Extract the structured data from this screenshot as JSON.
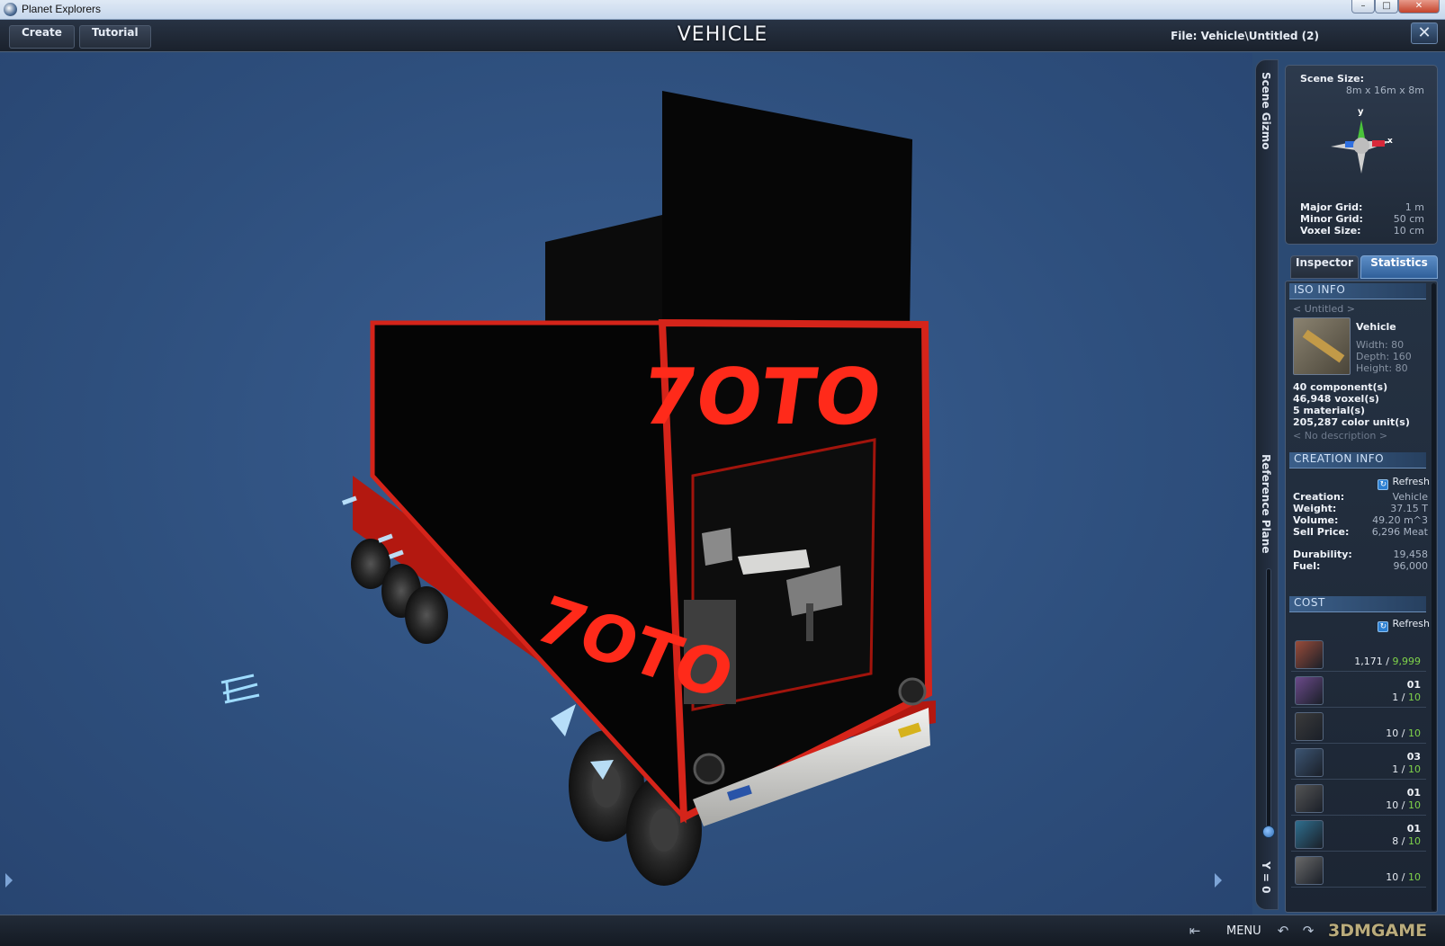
{
  "os_window": {
    "title": "Planet Explorers",
    "controls": {
      "minimize": "–",
      "maximize": "□",
      "close": "✕"
    }
  },
  "header": {
    "create_label": "Create",
    "tutorial_label": "Tutorial",
    "title": "VEHICLE",
    "file_path": "File:  Vehicle\\Untitled (2)",
    "close_glyph": "✕"
  },
  "model": {
    "front_logo": "7OTO",
    "side_logo": "7OTO",
    "colors": {
      "body": "#070707",
      "frame": "#c41a12",
      "glow": "#ff2a1a",
      "bumper": "#d7d7d5",
      "bg": "#2e4f7d"
    }
  },
  "side_labels": {
    "scene_gizmo": "Scene Gizmo",
    "reference_plane": "Reference Plane",
    "y_value": "Y = 0"
  },
  "scene": {
    "size_label": "Scene Size:",
    "size_value": "8m x 16m x 8m",
    "axis_y": "y",
    "axis_x": "x",
    "major_grid_label": "Major Grid:",
    "major_grid_value": "1 m",
    "minor_grid_label": "Minor Grid:",
    "minor_grid_value": "50 cm",
    "voxel_size_label": "Voxel Size:",
    "voxel_size_value": "10 cm"
  },
  "tabs": {
    "inspector": "Inspector",
    "statistics": "Statistics"
  },
  "iso_info": {
    "header": "ISO INFO",
    "name": "< Untitled >",
    "type": "Vehicle",
    "width": "Width: 80",
    "depth": "Depth: 160",
    "height": "Height: 80",
    "components": "40 component(s)",
    "voxels": "46,948 voxel(s)",
    "materials": "5 material(s)",
    "color_units": "205,287 color unit(s)",
    "description": "< No description >"
  },
  "creation_info": {
    "header": "CREATION INFO",
    "refresh_label": "Refresh",
    "creation_label": "Creation:",
    "creation_value": "Vehicle",
    "weight_label": "Weight:",
    "weight_value": "37.15 T",
    "volume_label": "Volume:",
    "volume_value": "49.20 m^3",
    "sell_price_label": "Sell Price:",
    "sell_price_value": "6,296 Meat",
    "durability_label": "Durability:",
    "durability_value": "19,458",
    "fuel_label": "Fuel:",
    "fuel_value": "96,000"
  },
  "cost": {
    "header": "COST",
    "refresh_label": "Refresh",
    "items": [
      {
        "name": "",
        "have": "1,171",
        "max": "9,999",
        "icon": "material-block-icon",
        "color": "#9a4c3a"
      },
      {
        "name": "01",
        "have": "1",
        "max": "10",
        "icon": "seat-icon",
        "color": "#6b4a8a"
      },
      {
        "name": "",
        "have": "10",
        "max": "10",
        "icon": "wheel-icon",
        "color": "#3b3b3b"
      },
      {
        "name": "03",
        "have": "1",
        "max": "10",
        "icon": "engine-icon",
        "color": "#3c5573"
      },
      {
        "name": "01",
        "have": "10",
        "max": "10",
        "icon": "headlight-icon",
        "color": "#555"
      },
      {
        "name": "01",
        "have": "8",
        "max": "10",
        "icon": "fuel-cell-icon",
        "color": "#2f6f8f"
      },
      {
        "name": "",
        "have": "10",
        "max": "10",
        "icon": "chair-icon",
        "color": "#6a6a6a"
      }
    ]
  },
  "bottom": {
    "menu_label": "MENU",
    "watermark": "3DMGAME"
  }
}
